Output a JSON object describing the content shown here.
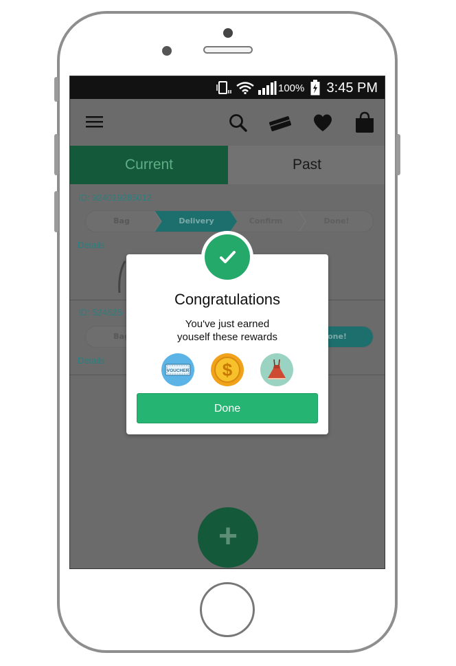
{
  "status_bar": {
    "battery_percent": "100%",
    "time": "3:45 PM",
    "icons": [
      "vibrate-icon",
      "wifi-icon",
      "signal-icon",
      "battery-charging-icon"
    ]
  },
  "toolbar": {
    "icons": [
      "menu-icon",
      "search-icon",
      "ticket-icon",
      "heart-icon",
      "shopping-bag-icon"
    ]
  },
  "tabs": {
    "current": "Current",
    "past": "Past",
    "active": "Current"
  },
  "orders": [
    {
      "id": "ID: 924019285012",
      "steps": [
        "Bag",
        "Delivery",
        "Confirm",
        "Done!"
      ],
      "active_step": "Delivery",
      "details": "Details"
    },
    {
      "id": "ID: 524625",
      "steps_visible": [
        "Bag",
        "one!"
      ],
      "details": "Details"
    }
  ],
  "modal": {
    "title": "Congratulations",
    "message_line1": "You've just earned",
    "message_line2": "youself these rewards",
    "rewards": [
      {
        "icon": "voucher-icon",
        "label": "VOUCHER"
      },
      {
        "icon": "coin-icon",
        "label": "$"
      },
      {
        "icon": "dress-icon"
      }
    ],
    "done_label": "Done"
  },
  "fab": {
    "label": "+"
  },
  "colors": {
    "primary_green": "#25b471",
    "dark_green": "#14593a",
    "teal_text": "#2b7f7f",
    "overlay_gray": "#6b6b6b"
  }
}
